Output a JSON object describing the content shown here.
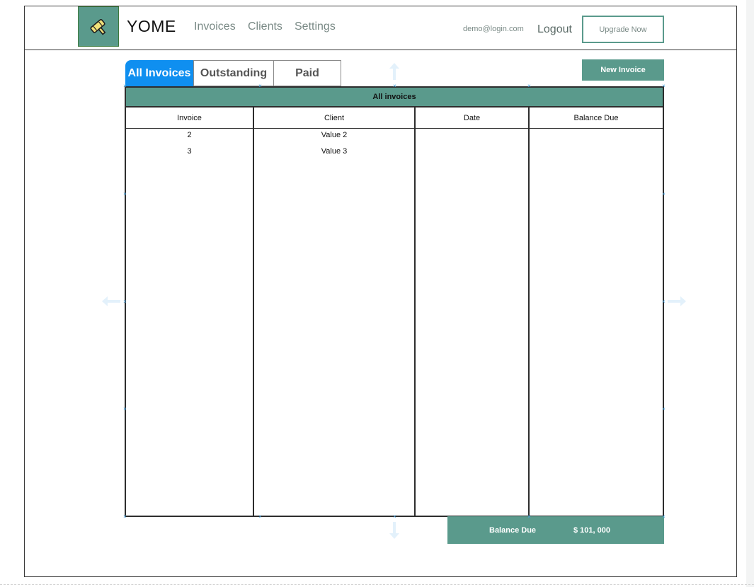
{
  "header": {
    "brand": "YOME",
    "nav": [
      "Invoices",
      "Clients",
      "Settings"
    ],
    "user_email": "demo@login.com",
    "logout_label": "Logout",
    "upgrade_label": "Upgrade Now"
  },
  "tabs": [
    {
      "label": "All Invoices",
      "active": true
    },
    {
      "label": "Outstanding",
      "active": false
    },
    {
      "label": "Paid",
      "active": false
    }
  ],
  "actions": {
    "new_invoice_label": "New Invoice"
  },
  "table": {
    "caption": "All invoices",
    "columns": [
      "Invoice",
      "Client",
      "Date",
      "Balance Due"
    ],
    "rows": [
      {
        "invoice": "2",
        "client": "Value 2",
        "date": "",
        "balance": ""
      },
      {
        "invoice": "3",
        "client": "Value 3",
        "date": "",
        "balance": ""
      }
    ]
  },
  "footer": {
    "balance_label": "Balance Due",
    "balance_value": "$ 101, 000"
  },
  "colors": {
    "accent": "#5a9a8c",
    "active_tab": "#0f8ff0",
    "border": "#2d2d2d",
    "muted_text": "#7a8a86"
  },
  "icons": {
    "logo": "hammer-logo-icon",
    "resize_arrows": "resize-arrow-icon"
  }
}
